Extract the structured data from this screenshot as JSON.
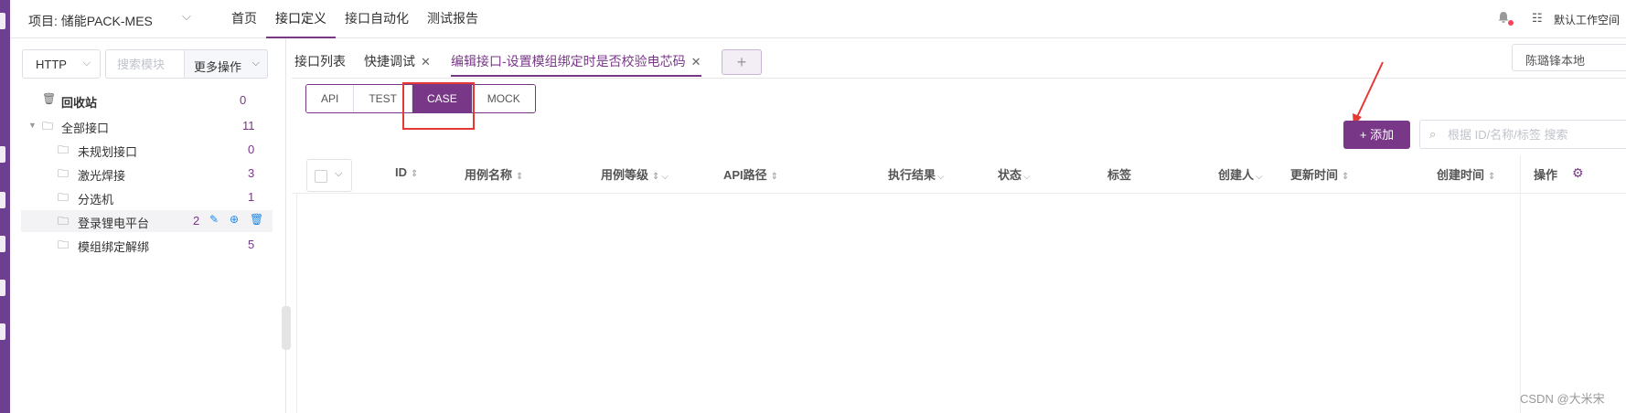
{
  "header": {
    "project_label": "项目: 储能PACK-MES",
    "nav": [
      "首页",
      "接口定义",
      "接口自动化",
      "测试报告"
    ],
    "active_nav_index": 1,
    "workspace": "默认工作空间"
  },
  "left_panel": {
    "protocol": "HTTP",
    "search_placeholder": "搜索模块",
    "more_ops": "更多操作",
    "recycle": {
      "label": "回收站",
      "count": "0"
    },
    "all": {
      "label": "全部接口",
      "count": "11"
    },
    "modules": [
      {
        "label": "未规划接口",
        "count": "0"
      },
      {
        "label": "激光焊接",
        "count": "3"
      },
      {
        "label": "分选机",
        "count": "1"
      },
      {
        "label": "登录锂电平台",
        "count": "2"
      },
      {
        "label": "模组绑定解绑",
        "count": "5"
      }
    ],
    "hovered_module_index": 3
  },
  "tabs": {
    "items": [
      "接口列表",
      "快捷调试",
      "编辑接口-设置模组绑定时是否校验电芯码"
    ],
    "active_index": 2,
    "add": "+"
  },
  "environment": "陈璐锋本地",
  "segments": {
    "items": [
      "API",
      "TEST",
      "CASE",
      "MOCK"
    ],
    "active_index": 2
  },
  "toolbar": {
    "add_label": "+ 添加",
    "search_placeholder": "根据 ID/名称/标签 搜索"
  },
  "table": {
    "columns": [
      "ID",
      "用例名称",
      "用例等级",
      "API路径",
      "执行结果",
      "状态",
      "标签",
      "创建人",
      "更新时间",
      "创建时间",
      "操作"
    ],
    "rows": []
  },
  "watermark": "CSDN @大米宋",
  "colors": {
    "brand": "#783887",
    "highlight": "#e53935"
  }
}
